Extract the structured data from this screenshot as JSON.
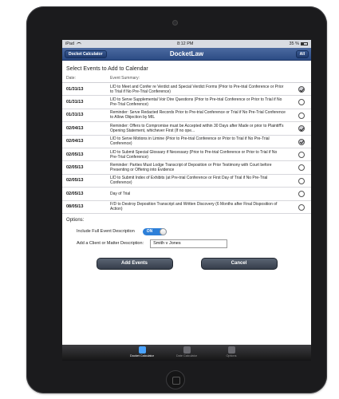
{
  "status_bar": {
    "device": "iPad",
    "time": "8:12 PM",
    "battery": "35 %"
  },
  "nav": {
    "title": "DocketLaw",
    "left_button": "Docket Calculator",
    "right_button": "All"
  },
  "main": {
    "heading": "Select Events to Add to Calendar",
    "col_date": "Date:",
    "col_summary": "Event Summary:"
  },
  "events": [
    {
      "date": "01/31/13",
      "summary": "L/D to Meet and Confer re Verdict and Special Verdict Forms (Prior to Pre-trial Conference or Prior to Trial if No Pre-Trial Conference)",
      "checked": true
    },
    {
      "date": "01/31/13",
      "summary": "L/D to Serve Supplemental Voir Dire Questions (Prior to Pre-trial Conference or Prior to Trial if No Pre-Trial Conference)",
      "checked": false
    },
    {
      "date": "01/31/13",
      "summary": "Reminder: Serve Redacted Records Prior to Pre-trial Conference or Trial if No Pre-Trial Conference to Allow Objection by MIL",
      "checked": false
    },
    {
      "date": "02/04/13",
      "summary": "Reminder: Offers to Compromise must be Accepted within 30 Days after Made or prior to Plaintiff's Opening Statement, whichever First (If no ope...",
      "checked": true
    },
    {
      "date": "02/04/13",
      "summary": "L/D to Serve Motions in Limine (Prior to Pre-trial Conference or Prior to Trial if No Pre-Trial Conference)",
      "checked": true
    },
    {
      "date": "02/05/13",
      "summary": "L/D to Submit Special Glossary if Necessary (Prior to Pre-trial Conference or Prior to Trial if No Pre-Trial Conference)",
      "checked": false
    },
    {
      "date": "02/05/13",
      "summary": "Reminder: Parties Must Lodge Transcript of Deposition or Prior Testimony with Court before Presenting or Offering into Evidence",
      "checked": false
    },
    {
      "date": "02/05/13",
      "summary": "L/D to Submit Index of Exhibits (at Pre-trial Conference or First Day of Trial if No Pre-Trial Conference)",
      "checked": false
    },
    {
      "date": "02/05/13",
      "summary": "Day of Trial",
      "checked": false
    },
    {
      "date": "08/05/13",
      "summary": "F/D to Destroy Deposition Transcript and Written Discovery (6 Months after Final Disposition of Action)",
      "checked": false
    }
  ],
  "options": {
    "label": "Options:",
    "full_desc_label": "Include Full Event Description",
    "toggle_text": "ON",
    "client_label": "Add a Client or Matter Description:",
    "client_value": "Smith v Jones"
  },
  "buttons": {
    "add": "Add Events",
    "cancel": "Cancel"
  },
  "tabs": [
    {
      "label": "Docket Calculator",
      "icon": "calendar-icon",
      "active": true
    },
    {
      "label": "Date Calculator",
      "icon": "calculator-icon",
      "active": false
    },
    {
      "label": "Options",
      "icon": "gear-icon",
      "active": false
    }
  ]
}
